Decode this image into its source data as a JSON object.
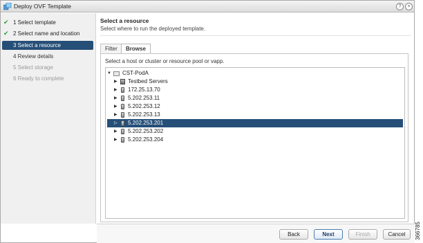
{
  "window": {
    "title": "Deploy OVF Template",
    "help_glyph": "?",
    "close_glyph": "×"
  },
  "nav": {
    "steps": [
      {
        "label": "1  Select template",
        "state": "done"
      },
      {
        "label": "2  Select name and location",
        "state": "done"
      },
      {
        "label": "3  Select a resource",
        "state": "active"
      },
      {
        "label": "4  Review details",
        "state": "pending"
      },
      {
        "label": "5  Select storage",
        "state": "disabled"
      },
      {
        "label": "6  Ready to complete",
        "state": "disabled"
      }
    ]
  },
  "main": {
    "heading": "Select a resource",
    "subheading": "Select where to run the deployed template.",
    "tabs": [
      {
        "label": "Filter"
      },
      {
        "label": "Browse",
        "selected": true
      }
    ],
    "instruction": "Select a host or cluster or resource pool or vapp.",
    "tree": [
      {
        "label": "CST-PodA",
        "type": "datacenter",
        "expanded": true
      },
      {
        "label": "Testbed Servers",
        "type": "cluster"
      },
      {
        "label": "172.25.13.70",
        "type": "host"
      },
      {
        "label": "5.202.253.11",
        "type": "host"
      },
      {
        "label": "5.202.253.12",
        "type": "host"
      },
      {
        "label": "5.202.253.13",
        "type": "host"
      },
      {
        "label": "5.202.253.201",
        "type": "host",
        "selected": true
      },
      {
        "label": "5.202.253.202",
        "type": "host"
      },
      {
        "label": "5.202.253.204",
        "type": "host"
      }
    ]
  },
  "footer": {
    "back_label": "Back",
    "next_label": "Next",
    "finish_label": "Finish",
    "cancel_label": "Cancel"
  },
  "figure_id": "366785",
  "colors": {
    "selection": "#264f78",
    "check": "#2c9a3c"
  }
}
